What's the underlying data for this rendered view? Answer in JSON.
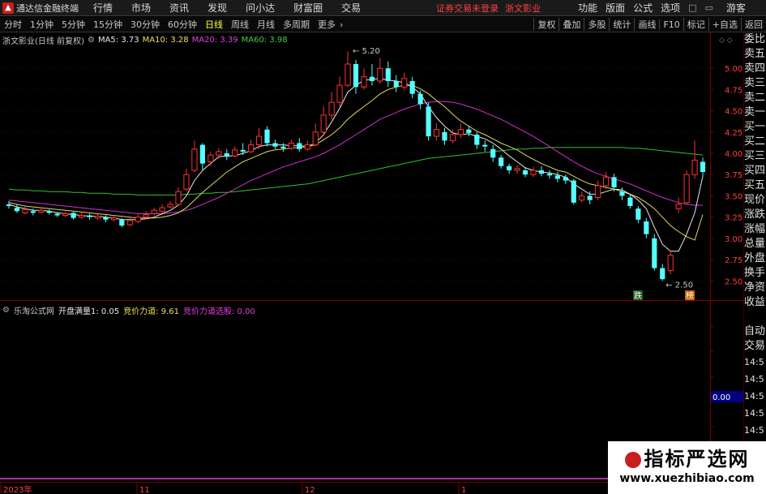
{
  "app": {
    "title": "通达信金融终端",
    "menu": [
      "行情",
      "市场",
      "资讯",
      "发现",
      "问小达",
      "财富圈",
      "交易"
    ],
    "notice": "证券交易未登录",
    "stock_name_top": "浙文影业",
    "right_menu": [
      "功能",
      "版面",
      "公式",
      "选项"
    ],
    "user": "游客"
  },
  "periods": {
    "items": [
      "分时",
      "1分钟",
      "5分钟",
      "15分钟",
      "30分钟",
      "60分钟",
      "日线",
      "周线",
      "月线",
      "多周期",
      "更多"
    ],
    "active": "日线",
    "tools": [
      "复权",
      "叠加",
      "多股",
      "统计",
      "画线",
      "F10",
      "标记",
      "+自选",
      "返回"
    ]
  },
  "main_info": {
    "title": "浙文影业(日线 前复权)",
    "ma5": "MA5: 3.73",
    "ma10": "MA10: 3.28",
    "ma20": "MA20: 3.39",
    "ma60": "MA60: 3.98",
    "high_label": "5.20",
    "low_label": "2.50",
    "tag_die": "跌",
    "tag_bang": "榜"
  },
  "sub_info": {
    "title": "乐淘公式网",
    "open_full": "开盘满量1: 0.05",
    "auction": "竞价力道: 9.61",
    "auction_select": "竞价力道选股: 0.00",
    "right_value": "0.00"
  },
  "axis": {
    "price_ticks": [
      "5.00",
      "4.75",
      "4.50",
      "4.25",
      "4.00",
      "3.75",
      "3.50",
      "3.25",
      "3.00",
      "2.75",
      "2.50"
    ],
    "dates": [
      "2023年",
      "11",
      "12",
      "1"
    ]
  },
  "right_panel": {
    "labels": [
      "委比",
      "卖五",
      "卖四",
      "卖三",
      "卖二",
      "卖一",
      "买一",
      "买二",
      "买三",
      "买四",
      "买五",
      "现价",
      "涨跌",
      "涨幅",
      "总量",
      "外盘",
      "换手",
      "净资",
      "收益",
      "",
      "自动",
      "交易"
    ],
    "times": [
      "14:5",
      "14:5",
      "14:5",
      "14:5",
      "14:5",
      "14:5",
      "14:5",
      "14:5",
      "14:5"
    ]
  },
  "watermark": {
    "line1": "指标严选网",
    "line2": "www.xuezhibiao.com"
  },
  "chart_data": {
    "type": "candlestick",
    "price_range": [
      2.35,
      5.25
    ],
    "candles": [
      [
        3.4,
        3.38,
        3.44,
        3.35
      ],
      [
        3.36,
        3.32,
        3.4,
        3.3
      ],
      [
        3.3,
        3.34,
        3.37,
        3.28
      ],
      [
        3.32,
        3.3,
        3.35,
        3.27
      ],
      [
        3.31,
        3.33,
        3.36,
        3.29
      ],
      [
        3.32,
        3.3,
        3.34,
        3.28
      ],
      [
        3.29,
        3.27,
        3.31,
        3.25
      ],
      [
        3.27,
        3.29,
        3.32,
        3.25
      ],
      [
        3.3,
        3.24,
        3.31,
        3.22
      ],
      [
        3.25,
        3.27,
        3.3,
        3.23
      ],
      [
        3.27,
        3.25,
        3.29,
        3.22
      ],
      [
        3.24,
        3.26,
        3.29,
        3.22
      ],
      [
        3.25,
        3.22,
        3.27,
        3.19
      ],
      [
        3.22,
        3.24,
        3.27,
        3.2
      ],
      [
        3.22,
        3.15,
        3.24,
        3.13
      ],
      [
        3.16,
        3.21,
        3.24,
        3.14
      ],
      [
        3.2,
        3.25,
        3.28,
        3.18
      ],
      [
        3.25,
        3.28,
        3.32,
        3.23
      ],
      [
        3.29,
        3.33,
        3.36,
        3.27
      ],
      [
        3.32,
        3.36,
        3.4,
        3.3
      ],
      [
        3.37,
        3.4,
        3.44,
        3.35
      ],
      [
        3.4,
        3.55,
        3.6,
        3.38
      ],
      [
        3.58,
        3.75,
        3.82,
        3.55
      ],
      [
        3.8,
        4.05,
        4.15,
        3.78
      ],
      [
        4.1,
        3.88,
        4.12,
        3.8
      ],
      [
        3.9,
        3.98,
        4.02,
        3.85
      ],
      [
        3.98,
        4.02,
        4.06,
        3.94
      ],
      [
        4.0,
        3.96,
        4.05,
        3.92
      ],
      [
        3.97,
        4.04,
        4.08,
        3.95
      ],
      [
        4.04,
        4.02,
        4.12,
        3.98
      ],
      [
        4.02,
        4.1,
        4.16,
        4.0
      ],
      [
        4.1,
        4.2,
        4.3,
        4.05
      ],
      [
        4.28,
        4.12,
        4.32,
        4.08
      ],
      [
        4.12,
        4.08,
        4.16,
        4.05
      ],
      [
        4.08,
        4.06,
        4.12,
        4.02
      ],
      [
        4.06,
        4.12,
        4.16,
        4.04
      ],
      [
        4.12,
        4.05,
        4.18,
        4.02
      ],
      [
        4.05,
        4.1,
        4.15,
        4.03
      ],
      [
        4.1,
        4.25,
        4.35,
        4.08
      ],
      [
        4.25,
        4.45,
        4.55,
        4.2
      ],
      [
        4.45,
        4.6,
        4.72,
        4.4
      ],
      [
        4.6,
        4.8,
        4.9,
        4.55
      ],
      [
        4.8,
        5.05,
        5.2,
        4.78
      ],
      [
        5.05,
        4.78,
        5.1,
        4.7
      ],
      [
        4.78,
        4.9,
        5.0,
        4.75
      ],
      [
        4.9,
        4.85,
        5.05,
        4.8
      ],
      [
        4.85,
        5.0,
        5.12,
        4.82
      ],
      [
        5.0,
        4.85,
        5.08,
        4.78
      ],
      [
        4.85,
        4.78,
        4.92,
        4.72
      ],
      [
        4.78,
        4.88,
        4.95,
        4.74
      ],
      [
        4.85,
        4.7,
        4.9,
        4.65
      ],
      [
        4.7,
        4.58,
        4.74,
        4.52
      ],
      [
        4.55,
        4.2,
        4.6,
        4.15
      ],
      [
        4.2,
        4.28,
        4.35,
        4.15
      ],
      [
        4.25,
        4.15,
        4.3,
        4.1
      ],
      [
        4.15,
        4.22,
        4.28,
        4.12
      ],
      [
        4.22,
        4.28,
        4.35,
        4.18
      ],
      [
        4.28,
        4.24,
        4.32,
        4.2
      ],
      [
        4.22,
        4.1,
        4.25,
        4.05
      ],
      [
        4.1,
        4.08,
        4.15,
        4.02
      ],
      [
        4.05,
        3.95,
        4.1,
        3.9
      ],
      [
        3.95,
        3.85,
        3.98,
        3.82
      ],
      [
        3.85,
        3.8,
        3.88,
        3.76
      ],
      [
        3.8,
        3.82,
        3.86,
        3.76
      ],
      [
        3.8,
        3.75,
        3.84,
        3.72
      ],
      [
        3.75,
        3.8,
        3.84,
        3.72
      ],
      [
        3.8,
        3.76,
        3.85,
        3.73
      ],
      [
        3.76,
        3.74,
        3.8,
        3.7
      ],
      [
        3.74,
        3.7,
        3.78,
        3.66
      ],
      [
        3.72,
        3.68,
        3.75,
        3.64
      ],
      [
        3.68,
        3.42,
        3.7,
        3.4
      ],
      [
        3.45,
        3.5,
        3.55,
        3.42
      ],
      [
        3.5,
        3.45,
        3.55,
        3.4
      ],
      [
        3.48,
        3.62,
        3.68,
        3.45
      ],
      [
        3.62,
        3.72,
        3.78,
        3.58
      ],
      [
        3.72,
        3.6,
        3.76,
        3.55
      ],
      [
        3.55,
        3.5,
        3.6,
        3.45
      ],
      [
        3.48,
        3.38,
        3.52,
        3.35
      ],
      [
        3.35,
        3.22,
        3.38,
        3.18
      ],
      [
        3.2,
        3.05,
        3.24,
        3.0
      ],
      [
        3.0,
        2.65,
        3.05,
        2.62
      ],
      [
        2.65,
        2.52,
        2.7,
        2.5
      ],
      [
        2.62,
        2.8,
        2.85,
        2.58
      ],
      [
        3.35,
        3.4,
        3.48,
        3.3
      ],
      [
        3.42,
        3.75,
        3.8,
        3.4
      ],
      [
        3.75,
        3.92,
        4.15,
        3.7
      ],
      [
        3.9,
        3.78,
        3.95,
        3.72
      ]
    ],
    "ma5": [
      3.4,
      3.37,
      3.35,
      3.33,
      3.33,
      3.32,
      3.3,
      3.29,
      3.28,
      3.27,
      3.26,
      3.26,
      3.25,
      3.24,
      3.22,
      3.22,
      3.22,
      3.23,
      3.25,
      3.29,
      3.33,
      3.39,
      3.5,
      3.68,
      3.8,
      3.88,
      3.96,
      3.97,
      3.97,
      4.0,
      4.03,
      4.08,
      4.1,
      4.1,
      4.1,
      4.09,
      4.09,
      4.08,
      4.12,
      4.22,
      4.37,
      4.53,
      4.72,
      4.8,
      4.86,
      4.87,
      4.88,
      4.86,
      4.85,
      4.83,
      4.78,
      4.7,
      4.55,
      4.42,
      4.32,
      4.24,
      4.22,
      4.23,
      4.2,
      4.17,
      4.12,
      4.05,
      3.97,
      3.9,
      3.83,
      3.8,
      3.78,
      3.77,
      3.75,
      3.72,
      3.64,
      3.58,
      3.52,
      3.52,
      3.55,
      3.58,
      3.57,
      3.52,
      3.45,
      3.35,
      3.13,
      2.93,
      2.85,
      2.85,
      3.05,
      3.3,
      3.73
    ],
    "ma10": [
      3.42,
      3.4,
      3.38,
      3.37,
      3.36,
      3.35,
      3.34,
      3.33,
      3.32,
      3.31,
      3.3,
      3.29,
      3.28,
      3.27,
      3.26,
      3.25,
      3.24,
      3.24,
      3.24,
      3.25,
      3.27,
      3.3,
      3.36,
      3.45,
      3.54,
      3.62,
      3.7,
      3.78,
      3.84,
      3.9,
      3.94,
      3.98,
      4.02,
      4.04,
      4.05,
      4.06,
      4.07,
      4.08,
      4.1,
      4.16,
      4.22,
      4.3,
      4.4,
      4.48,
      4.55,
      4.62,
      4.7,
      4.75,
      4.78,
      4.8,
      4.8,
      4.76,
      4.7,
      4.62,
      4.55,
      4.46,
      4.38,
      4.32,
      4.26,
      4.22,
      4.17,
      4.12,
      4.08,
      4.04,
      3.98,
      3.93,
      3.88,
      3.84,
      3.8,
      3.78,
      3.73,
      3.68,
      3.64,
      3.62,
      3.6,
      3.58,
      3.55,
      3.52,
      3.48,
      3.42,
      3.35,
      3.25,
      3.15,
      3.08,
      3.02,
      2.98,
      3.28
    ],
    "ma20": [
      3.45,
      3.44,
      3.43,
      3.42,
      3.41,
      3.4,
      3.39,
      3.38,
      3.37,
      3.36,
      3.35,
      3.34,
      3.33,
      3.32,
      3.31,
      3.3,
      3.29,
      3.29,
      3.29,
      3.29,
      3.3,
      3.31,
      3.33,
      3.36,
      3.4,
      3.44,
      3.48,
      3.53,
      3.58,
      3.63,
      3.68,
      3.72,
      3.76,
      3.8,
      3.84,
      3.87,
      3.9,
      3.93,
      3.96,
      4.0,
      4.05,
      4.1,
      4.16,
      4.22,
      4.28,
      4.34,
      4.4,
      4.44,
      4.48,
      4.52,
      4.55,
      4.58,
      4.6,
      4.61,
      4.61,
      4.6,
      4.58,
      4.55,
      4.52,
      4.48,
      4.44,
      4.4,
      4.35,
      4.3,
      4.25,
      4.2,
      4.14,
      4.08,
      4.02,
      3.96,
      3.9,
      3.85,
      3.8,
      3.76,
      3.73,
      3.7,
      3.67,
      3.64,
      3.6,
      3.56,
      3.52,
      3.48,
      3.45,
      3.42,
      3.4,
      3.39,
      3.39
    ],
    "ma60": [
      3.58,
      3.57,
      3.57,
      3.56,
      3.56,
      3.55,
      3.55,
      3.55,
      3.54,
      3.54,
      3.53,
      3.53,
      3.53,
      3.52,
      3.52,
      3.52,
      3.51,
      3.51,
      3.51,
      3.51,
      3.51,
      3.51,
      3.52,
      3.52,
      3.53,
      3.53,
      3.54,
      3.54,
      3.55,
      3.56,
      3.57,
      3.58,
      3.59,
      3.6,
      3.61,
      3.62,
      3.63,
      3.64,
      3.66,
      3.68,
      3.7,
      3.72,
      3.74,
      3.76,
      3.78,
      3.8,
      3.82,
      3.84,
      3.86,
      3.88,
      3.9,
      3.92,
      3.94,
      3.95,
      3.96,
      3.97,
      3.98,
      3.99,
      4.0,
      4.01,
      4.02,
      4.03,
      4.04,
      4.05,
      4.05,
      4.06,
      4.06,
      4.07,
      4.07,
      4.07,
      4.07,
      4.07,
      4.07,
      4.07,
      4.07,
      4.07,
      4.07,
      4.06,
      4.06,
      4.05,
      4.04,
      4.03,
      4.02,
      4.01,
      4.0,
      3.99,
      3.98
    ]
  }
}
